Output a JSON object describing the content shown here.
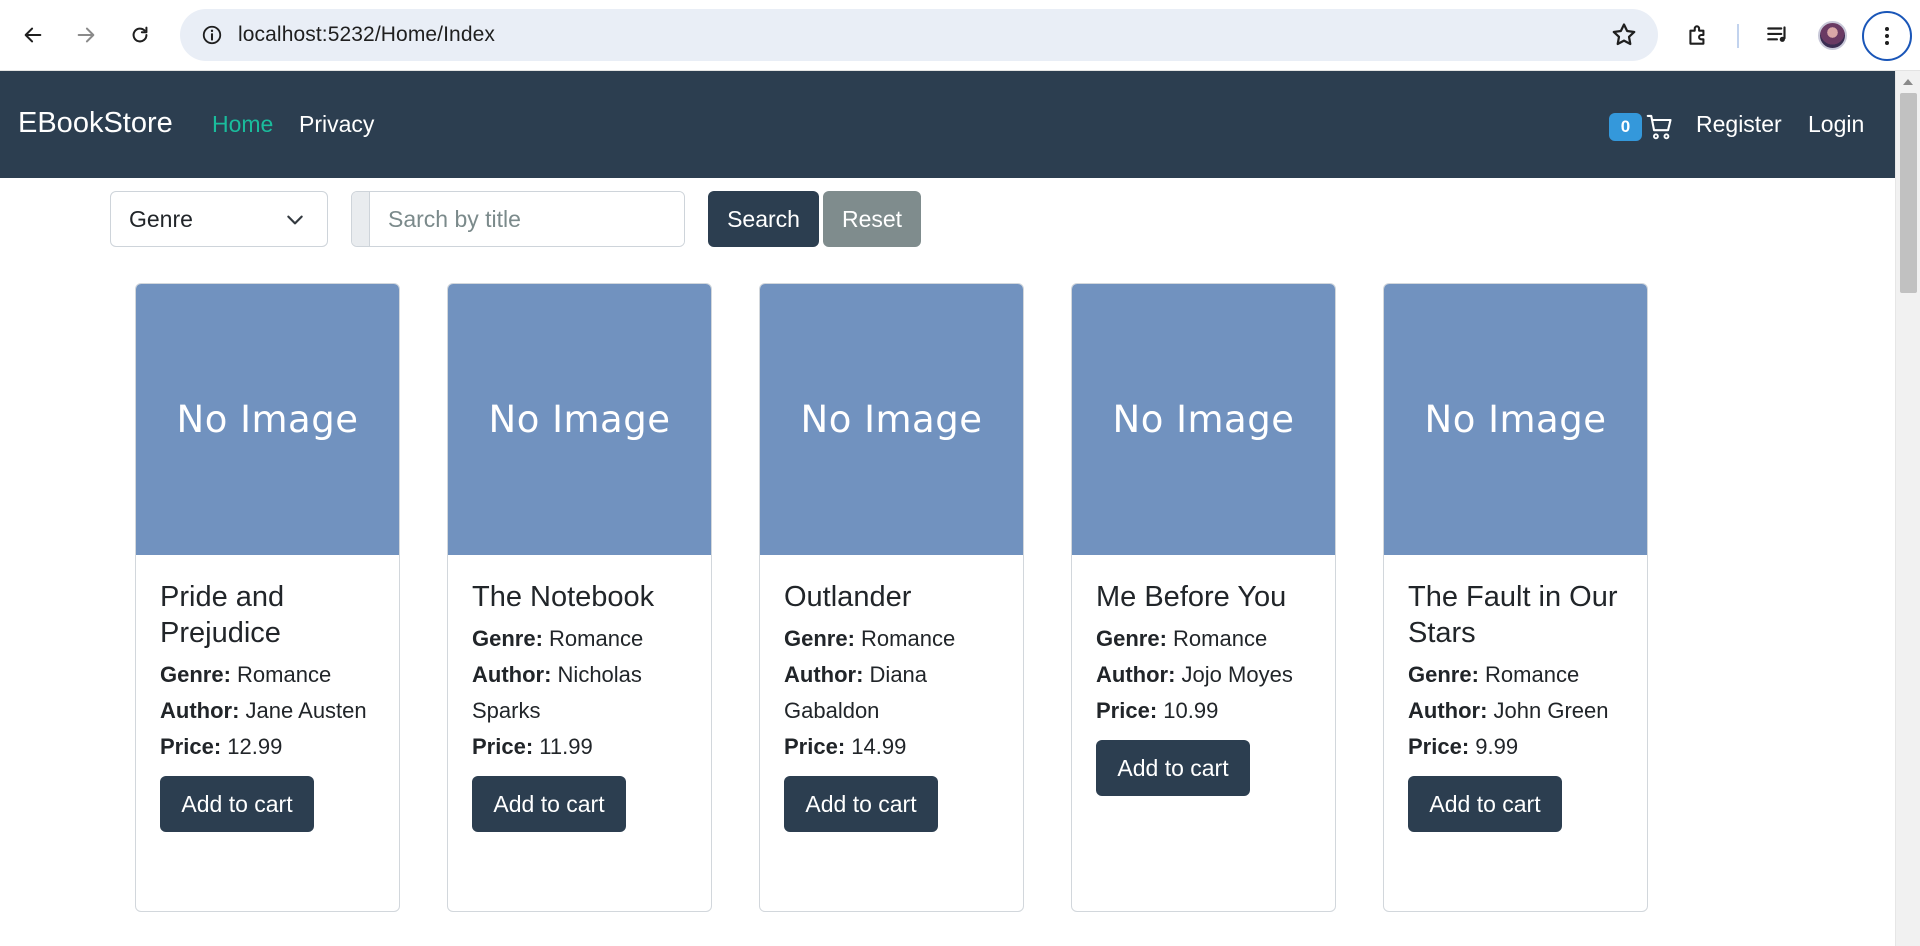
{
  "browser": {
    "url": "localhost:5232/Home/Index",
    "icons": [
      "back-icon",
      "forward-icon",
      "reload-icon",
      "site-info-icon",
      "bookmark-star-icon",
      "extensions-icon",
      "media-controls-icon",
      "profile-avatar",
      "more-menu-icon"
    ]
  },
  "navbar": {
    "brand": "EBookStore",
    "links": [
      {
        "label": "Home",
        "active": true
      },
      {
        "label": "Privacy",
        "active": false
      }
    ],
    "cart_count": "0",
    "register_label": "Register",
    "login_label": "Login",
    "colors": {
      "background": "#2c3e50",
      "active_link": "#1abc9c",
      "badge": "#3498db"
    }
  },
  "filters": {
    "genre_selected": "Genre",
    "search_placeholder": "Sarch by title",
    "search_value": "",
    "search_label": "Search",
    "reset_label": "Reset"
  },
  "labels": {
    "no_image": "No Image",
    "genre": "Genre:",
    "author": "Author:",
    "price": "Price:",
    "add_to_cart": "Add to cart"
  },
  "books": [
    {
      "title": "Pride and Prejudice",
      "genre": "Romance",
      "author": "Jane Austen",
      "price": "12.99"
    },
    {
      "title": "The Notebook",
      "genre": "Romance",
      "author": "Nicholas Sparks",
      "price": "11.99"
    },
    {
      "title": "Outlander",
      "genre": "Romance",
      "author": "Diana Gabaldon",
      "price": "14.99"
    },
    {
      "title": "Me Before You",
      "genre": "Romance",
      "author": "Jojo Moyes",
      "price": "10.99"
    },
    {
      "title": "The Fault in Our Stars",
      "genre": "Romance",
      "author": "John Green",
      "price": "9.99"
    }
  ]
}
